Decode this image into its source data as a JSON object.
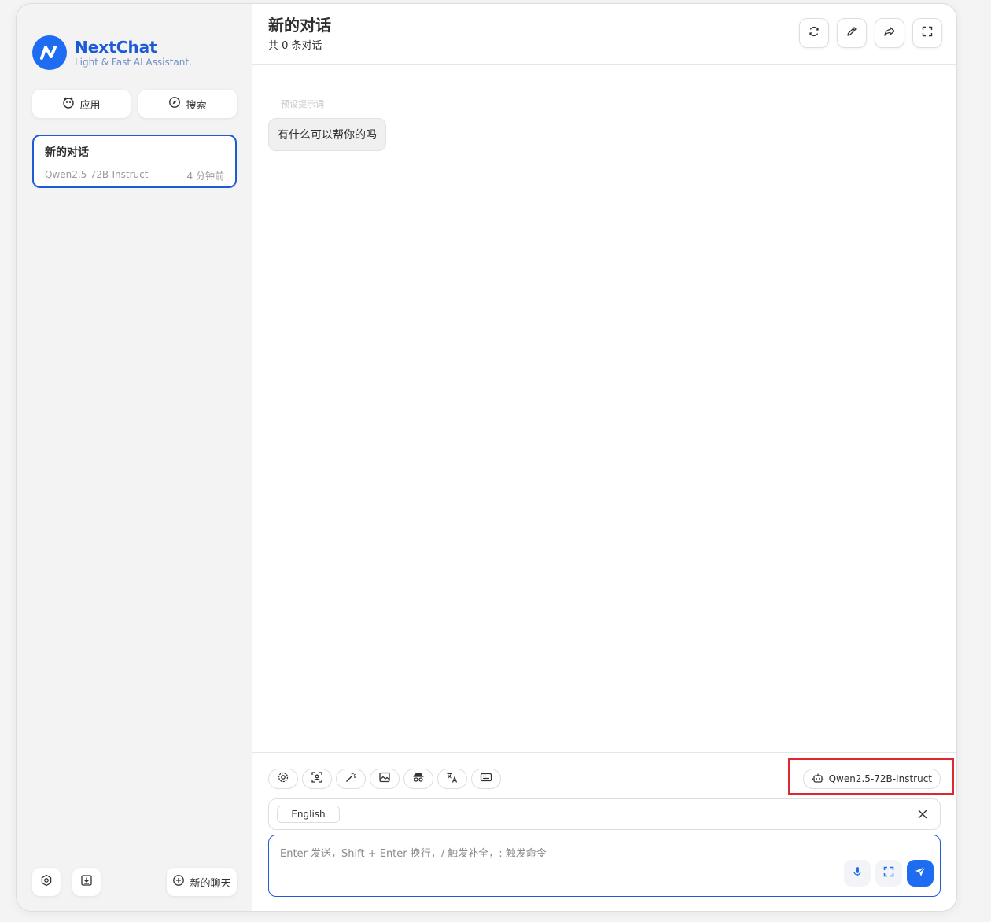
{
  "brand": {
    "title": "NextChat",
    "subtitle": "Light & Fast AI Assistant."
  },
  "sidebar": {
    "apps_label": "应用",
    "search_label": "搜索",
    "chat_item": {
      "title": "新的对话",
      "model": "Qwen2.5-72B-Instruct",
      "time": "4 分钟前"
    },
    "new_chat_label": "新的聊天"
  },
  "header": {
    "title": "新的对话",
    "subtitle": "共 0 条对话"
  },
  "messages": {
    "hint": "预设提示词",
    "bubble": "有什么可以帮你的吗"
  },
  "input": {
    "model_label": "Qwen2.5-72B-Instruct",
    "language_chip": "English",
    "placeholder": "Enter 发送，Shift + Enter 换行，/ 触发补全，: 触发命令"
  },
  "colors": {
    "accent": "#1d6cf2",
    "highlight": "#e0262e"
  }
}
